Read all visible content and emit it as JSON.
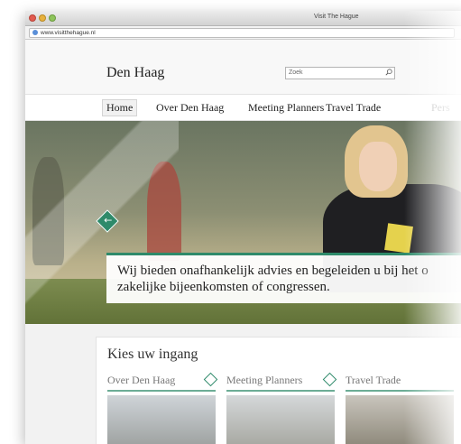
{
  "window": {
    "title": "Visit The Hague"
  },
  "browser": {
    "url": "www.visitthehague.nl"
  },
  "header": {
    "logo": "Den Haag",
    "search_placeholder": "Zoek"
  },
  "nav": {
    "items": [
      "Home",
      "Over Den Haag",
      "Meeting Planners",
      "Travel Trade",
      "Pers"
    ]
  },
  "hero": {
    "caption": "Wij bieden onafhankelijk advies en begeleiden u bij het o zakelijke bijeenkomsten of congressen."
  },
  "entries": {
    "title": "Kies uw ingang",
    "items": [
      "Over Den Haag",
      "Meeting Planners",
      "Travel Trade"
    ]
  },
  "colors": {
    "accent": "#2e8a6a"
  }
}
